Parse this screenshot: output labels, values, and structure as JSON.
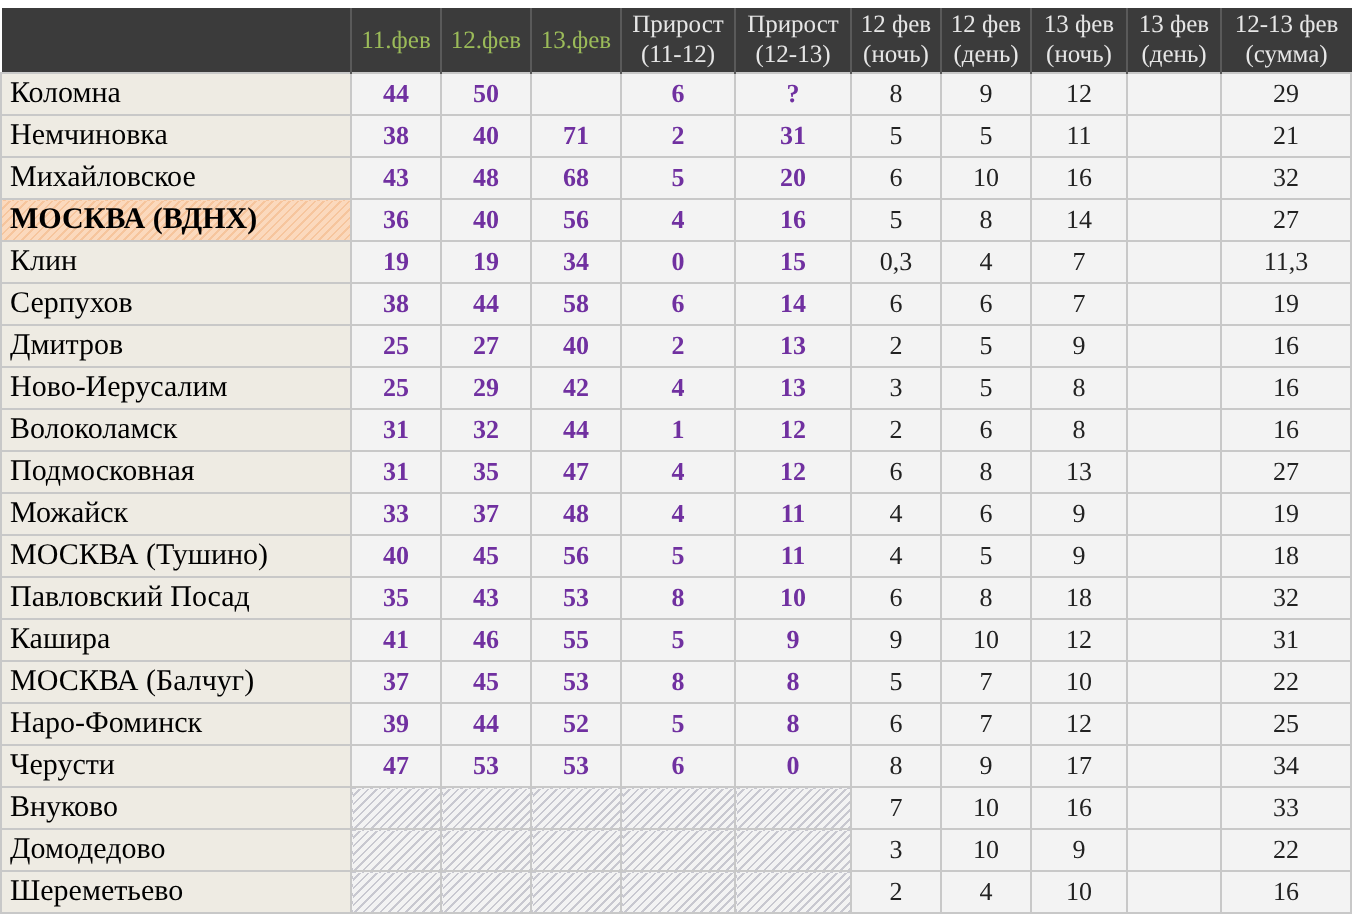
{
  "table": {
    "columns": [
      {
        "kind": "name"
      },
      {
        "kind": "date",
        "lines": [
          "11.фев"
        ]
      },
      {
        "kind": "date",
        "lines": [
          "12.фев"
        ]
      },
      {
        "kind": "date",
        "lines": [
          "13.фев"
        ]
      },
      {
        "kind": "text",
        "lines": [
          "Прирост",
          "(11-12)"
        ]
      },
      {
        "kind": "text",
        "lines": [
          "Прирост",
          "(12-13)"
        ]
      },
      {
        "kind": "text",
        "lines": [
          "12 фев",
          "(ночь)"
        ]
      },
      {
        "kind": "text",
        "lines": [
          "12 фев",
          "(день)"
        ]
      },
      {
        "kind": "text",
        "lines": [
          "13 фев",
          "(ночь)"
        ]
      },
      {
        "kind": "text",
        "lines": [
          "13 фев",
          "(день)"
        ]
      },
      {
        "kind": "text",
        "lines": [
          "12-13 фев",
          "(сумма)"
        ]
      }
    ],
    "rows": [
      {
        "kind": "station",
        "name": "Коломна",
        "highlighted": false,
        "observed": [
          {
            "text": "44"
          },
          {
            "text": "50"
          },
          {
            "kind": "empty"
          },
          {
            "text": "6"
          },
          {
            "text": "?"
          }
        ],
        "forecast": [
          {
            "text": "8"
          },
          {
            "text": "9"
          },
          {
            "text": "12"
          },
          {
            "kind": "empty"
          },
          {
            "text": "29"
          }
        ]
      },
      {
        "kind": "station",
        "name": "Немчиновка",
        "highlighted": false,
        "observed": [
          {
            "text": "38"
          },
          {
            "text": "40"
          },
          {
            "text": "71"
          },
          {
            "text": "2"
          },
          {
            "text": "31"
          }
        ],
        "forecast": [
          {
            "text": "5"
          },
          {
            "text": "5"
          },
          {
            "text": "11"
          },
          {
            "kind": "empty"
          },
          {
            "text": "21"
          }
        ]
      },
      {
        "kind": "station",
        "name": "Михайловское",
        "highlighted": false,
        "observed": [
          {
            "text": "43"
          },
          {
            "text": "48"
          },
          {
            "text": "68"
          },
          {
            "text": "5"
          },
          {
            "text": "20"
          }
        ],
        "forecast": [
          {
            "text": "6"
          },
          {
            "text": "10"
          },
          {
            "text": "16"
          },
          {
            "kind": "empty"
          },
          {
            "text": "32"
          }
        ]
      },
      {
        "kind": "station",
        "name": "МОСКВА (ВДНХ)",
        "highlighted": true,
        "observed": [
          {
            "text": "36"
          },
          {
            "text": "40"
          },
          {
            "text": "56"
          },
          {
            "text": "4"
          },
          {
            "text": "16"
          }
        ],
        "forecast": [
          {
            "text": "5"
          },
          {
            "text": "8"
          },
          {
            "text": "14"
          },
          {
            "kind": "empty"
          },
          {
            "text": "27"
          }
        ]
      },
      {
        "kind": "station",
        "name": "Клин",
        "highlighted": false,
        "observed": [
          {
            "text": "19"
          },
          {
            "text": "19"
          },
          {
            "text": "34"
          },
          {
            "text": "0"
          },
          {
            "text": "15"
          }
        ],
        "forecast": [
          {
            "text": "0,3"
          },
          {
            "text": "4"
          },
          {
            "text": "7"
          },
          {
            "kind": "empty"
          },
          {
            "text": "11,3"
          }
        ]
      },
      {
        "kind": "station",
        "name": "Серпухов",
        "highlighted": false,
        "observed": [
          {
            "text": "38"
          },
          {
            "text": "44"
          },
          {
            "text": "58"
          },
          {
            "text": "6"
          },
          {
            "text": "14"
          }
        ],
        "forecast": [
          {
            "text": "6"
          },
          {
            "text": "6"
          },
          {
            "text": "7"
          },
          {
            "kind": "empty"
          },
          {
            "text": "19"
          }
        ]
      },
      {
        "kind": "station",
        "name": "Дмитров",
        "highlighted": false,
        "observed": [
          {
            "text": "25"
          },
          {
            "text": "27"
          },
          {
            "text": "40"
          },
          {
            "text": "2"
          },
          {
            "text": "13"
          }
        ],
        "forecast": [
          {
            "text": "2"
          },
          {
            "text": "5"
          },
          {
            "text": "9"
          },
          {
            "kind": "empty"
          },
          {
            "text": "16"
          }
        ]
      },
      {
        "kind": "station",
        "name": "Ново-Иерусалим",
        "highlighted": false,
        "observed": [
          {
            "text": "25"
          },
          {
            "text": "29"
          },
          {
            "text": "42"
          },
          {
            "text": "4"
          },
          {
            "text": "13"
          }
        ],
        "forecast": [
          {
            "text": "3"
          },
          {
            "text": "5"
          },
          {
            "text": "8"
          },
          {
            "kind": "empty"
          },
          {
            "text": "16"
          }
        ]
      },
      {
        "kind": "station",
        "name": "Волоколамск",
        "highlighted": false,
        "observed": [
          {
            "text": "31"
          },
          {
            "text": "32"
          },
          {
            "text": "44"
          },
          {
            "text": "1"
          },
          {
            "text": "12"
          }
        ],
        "forecast": [
          {
            "text": "2"
          },
          {
            "text": "6"
          },
          {
            "text": "8"
          },
          {
            "kind": "empty"
          },
          {
            "text": "16"
          }
        ]
      },
      {
        "kind": "station",
        "name": "Подмосковная",
        "highlighted": false,
        "observed": [
          {
            "text": "31"
          },
          {
            "text": "35"
          },
          {
            "text": "47"
          },
          {
            "text": "4"
          },
          {
            "text": "12"
          }
        ],
        "forecast": [
          {
            "text": "6"
          },
          {
            "text": "8"
          },
          {
            "text": "13"
          },
          {
            "kind": "empty"
          },
          {
            "text": "27"
          }
        ]
      },
      {
        "kind": "station",
        "name": "Можайск",
        "highlighted": false,
        "observed": [
          {
            "text": "33"
          },
          {
            "text": "37"
          },
          {
            "text": "48"
          },
          {
            "text": "4"
          },
          {
            "text": "11"
          }
        ],
        "forecast": [
          {
            "text": "4"
          },
          {
            "text": "6"
          },
          {
            "text": "9"
          },
          {
            "kind": "empty"
          },
          {
            "text": "19"
          }
        ]
      },
      {
        "kind": "station",
        "name": "МОСКВА (Тушино)",
        "highlighted": false,
        "observed": [
          {
            "text": "40"
          },
          {
            "text": "45"
          },
          {
            "text": "56"
          },
          {
            "text": "5"
          },
          {
            "text": "11"
          }
        ],
        "forecast": [
          {
            "text": "4"
          },
          {
            "text": "5"
          },
          {
            "text": "9"
          },
          {
            "kind": "empty"
          },
          {
            "text": "18"
          }
        ]
      },
      {
        "kind": "station",
        "name": "Павловский Посад",
        "highlighted": false,
        "observed": [
          {
            "text": "35"
          },
          {
            "text": "43"
          },
          {
            "text": "53"
          },
          {
            "text": "8"
          },
          {
            "text": "10"
          }
        ],
        "forecast": [
          {
            "text": "6"
          },
          {
            "text": "8"
          },
          {
            "text": "18"
          },
          {
            "kind": "empty"
          },
          {
            "text": "32"
          }
        ]
      },
      {
        "kind": "station",
        "name": "Кашира",
        "highlighted": false,
        "observed": [
          {
            "text": "41"
          },
          {
            "text": "46"
          },
          {
            "text": "55"
          },
          {
            "text": "5"
          },
          {
            "text": "9"
          }
        ],
        "forecast": [
          {
            "text": "9"
          },
          {
            "text": "10"
          },
          {
            "text": "12"
          },
          {
            "kind": "empty"
          },
          {
            "text": "31"
          }
        ]
      },
      {
        "kind": "station",
        "name": "МОСКВА (Балчуг)",
        "highlighted": false,
        "observed": [
          {
            "text": "37"
          },
          {
            "text": "45"
          },
          {
            "text": "53"
          },
          {
            "text": "8"
          },
          {
            "text": "8"
          }
        ],
        "forecast": [
          {
            "text": "5"
          },
          {
            "text": "7"
          },
          {
            "text": "10"
          },
          {
            "kind": "empty"
          },
          {
            "text": "22"
          }
        ]
      },
      {
        "kind": "station",
        "name": "Наро-Фоминск",
        "highlighted": false,
        "observed": [
          {
            "text": "39"
          },
          {
            "text": "44"
          },
          {
            "text": "52"
          },
          {
            "text": "5"
          },
          {
            "text": "8"
          }
        ],
        "forecast": [
          {
            "text": "6"
          },
          {
            "text": "7"
          },
          {
            "text": "12"
          },
          {
            "kind": "empty"
          },
          {
            "text": "25"
          }
        ]
      },
      {
        "kind": "station",
        "name": "Черусти",
        "highlighted": false,
        "observed": [
          {
            "text": "47"
          },
          {
            "text": "53"
          },
          {
            "text": "53"
          },
          {
            "text": "6"
          },
          {
            "text": "0"
          }
        ],
        "forecast": [
          {
            "text": "8"
          },
          {
            "text": "9"
          },
          {
            "text": "17"
          },
          {
            "kind": "empty"
          },
          {
            "text": "34"
          }
        ]
      },
      {
        "kind": "airport",
        "name": "Внуково",
        "highlighted": false,
        "forecast": [
          {
            "text": "7"
          },
          {
            "text": "10"
          },
          {
            "text": "16"
          },
          {
            "kind": "empty"
          },
          {
            "text": "33"
          }
        ]
      },
      {
        "kind": "airport",
        "name": "Домодедово",
        "highlighted": false,
        "forecast": [
          {
            "text": "3"
          },
          {
            "text": "10"
          },
          {
            "text": "9"
          },
          {
            "kind": "empty"
          },
          {
            "text": "22"
          }
        ]
      },
      {
        "kind": "airport",
        "name": "Шереметьево",
        "highlighted": false,
        "forecast": [
          {
            "text": "2"
          },
          {
            "text": "4"
          },
          {
            "text": "10"
          },
          {
            "kind": "empty"
          },
          {
            "text": "16"
          }
        ]
      }
    ]
  }
}
